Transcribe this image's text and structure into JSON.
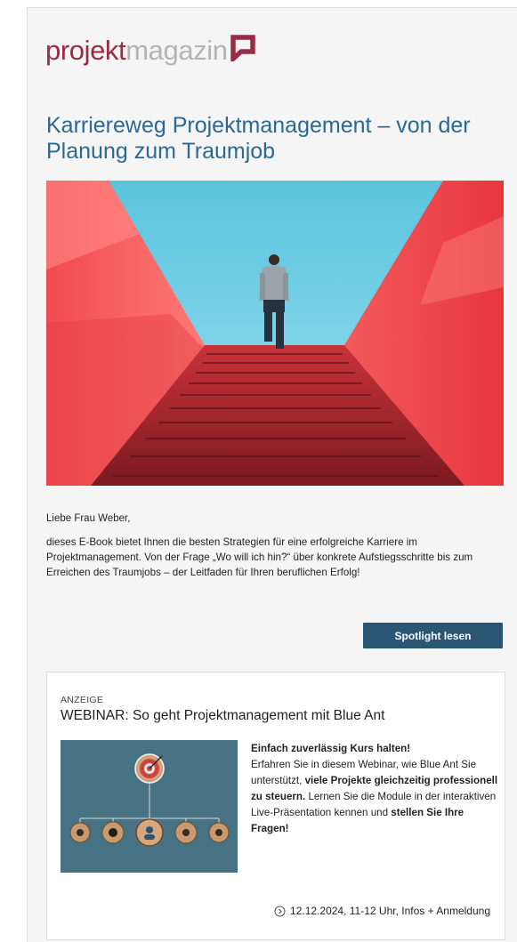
{
  "logo": {
    "part1": "projekt",
    "part2": "magazin"
  },
  "headline": "Karriereweg Projektmanagement – von der Planung zum Traumjob",
  "greeting": "Liebe Frau Weber,",
  "body": "dieses E-Book bietet Ihnen die besten Strategien für eine erfolgreiche Karriere im Projektmanagement. Von der Frage „Wo will ich hin?“ über konkrete Aufstiegsschritte bis zum Erreichen des Traumjobs – der Leitfaden für Ihren beruflichen Erfolg!",
  "cta_label": "Spotlight lesen",
  "ad": {
    "label": "ANZEIGE",
    "title": "WEBINAR: So geht Projektmanagement mit Blue Ant",
    "text_bold_1": "Einfach zuverlässig Kurs halten!",
    "text_1": "Erfahren Sie in diesem Webinar, wie Blue Ant Sie unterstützt,",
    "text_bold_2": "viele Projekte gleichzeitig professionell zu steuern.",
    "text_2": "Lernen Sie die Module in der interaktiven Live-Präsentation kennen und",
    "text_bold_3": "stellen Sie Ihre Fragen!",
    "footer_link": "12.12.2024, 11-12 Uhr, Infos + Anmeldung",
    "footer_icon": "chevron-circle-icon"
  },
  "colors": {
    "brand_red": "#9a2b44",
    "headline_blue": "#2d6891",
    "cta_bg": "#2a5674"
  }
}
